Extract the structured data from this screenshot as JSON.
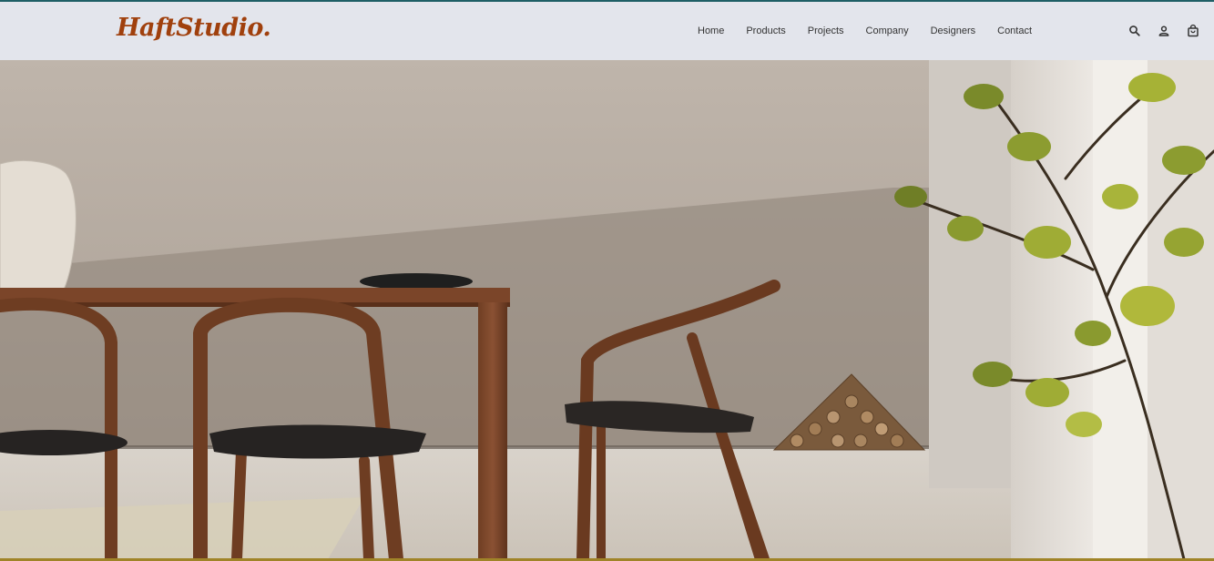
{
  "header": {
    "logo_text": "HaftStudio.",
    "nav": [
      {
        "label": "Home"
      },
      {
        "label": "Products"
      },
      {
        "label": "Projects"
      },
      {
        "label": "Company"
      },
      {
        "label": "Designers"
      },
      {
        "label": "Contact"
      }
    ],
    "icons": [
      "search-icon",
      "account-icon",
      "cart-icon"
    ]
  },
  "colors": {
    "header_bg": "#e3e5ec",
    "logo": "#a0400d",
    "top_accent": "#1f5f66",
    "bottom_accent": "#a08428"
  },
  "hero": {
    "image_subject": "dining-room-photo"
  }
}
